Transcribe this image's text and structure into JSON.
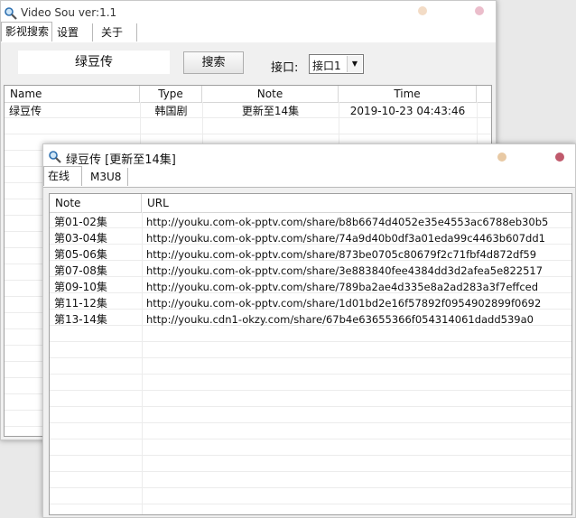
{
  "main_window": {
    "title": "Video Sou  ver:1.1",
    "tabs": [
      "影视搜索",
      "设置",
      "关于"
    ],
    "search_value": "绿豆传",
    "search_button": "搜索",
    "interface_label": "接口:",
    "interface_value": "接口1",
    "columns": [
      "Name",
      "Type",
      "Note",
      "Time"
    ],
    "rows": [
      {
        "name": "绿豆传",
        "type": "韩国剧",
        "note": "更新至14集",
        "time": "2019-10-23 04:43:46"
      }
    ]
  },
  "detail_window": {
    "title": "绿豆传 [更新至14集]",
    "tabs": [
      "在线",
      "M3U8"
    ],
    "columns": [
      "Note",
      "URL"
    ],
    "rows": [
      {
        "note": "第01-02集",
        "url": "http://youku.com-ok-pptv.com/share/b8b6674d4052e35e4553ac6788eb30b5"
      },
      {
        "note": "第03-04集",
        "url": "http://youku.com-ok-pptv.com/share/74a9d40b0df3a01eda99c4463b607dd1"
      },
      {
        "note": "第05-06集",
        "url": "http://youku.com-ok-pptv.com/share/873be0705c80679f2c71fbf4d872df59"
      },
      {
        "note": "第07-08集",
        "url": "http://youku.com-ok-pptv.com/share/3e883840fee4384dd3d2afea5e822517"
      },
      {
        "note": "第09-10集",
        "url": "http://youku.com-ok-pptv.com/share/789ba2ae4d335e8a2ad283a3f7effced"
      },
      {
        "note": "第11-12集",
        "url": "http://youku.com-ok-pptv.com/share/1d01bd2e16f57892f0954902899f0692"
      },
      {
        "note": "第13-14集",
        "url": "http://youku.cdn1-okzy.com/share/67b4e63655366f054314061dadd539a0"
      }
    ]
  },
  "colors": {
    "dot_minimize": "#f0d8c0",
    "dot_close": "#e8b8c8",
    "dot_minimize_2": "#e8c9a4",
    "dot_close_2": "#c05a6c"
  },
  "icons": [
    "magnifier-icon",
    "dropdown-arrow-icon"
  ]
}
